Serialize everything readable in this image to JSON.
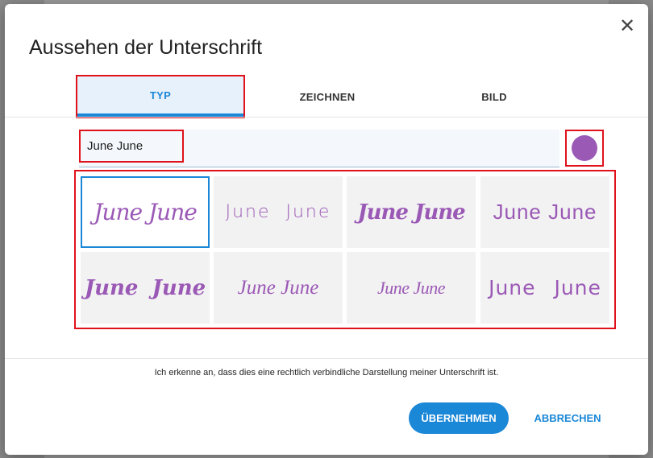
{
  "dialog": {
    "title": "Aussehen der Unterschrift",
    "close_icon": "close-icon"
  },
  "tabs": [
    {
      "label": "TYP",
      "active": true
    },
    {
      "label": "ZEICHNEN",
      "active": false
    },
    {
      "label": "BILD",
      "active": false
    }
  ],
  "name_input": {
    "value": "June June"
  },
  "color": {
    "selected": "#9b59b6",
    "icon": "color-picker-swatch"
  },
  "signature_styles": [
    {
      "text": "June June",
      "selected": true
    },
    {
      "text": "June June",
      "selected": false
    },
    {
      "text": "June June",
      "selected": false
    },
    {
      "text": "June June",
      "selected": false
    },
    {
      "text": "June June",
      "selected": false
    },
    {
      "text": "June June",
      "selected": false
    },
    {
      "text": "June June",
      "selected": false
    },
    {
      "text": "June June",
      "selected": false
    }
  ],
  "consent_text": "Ich erkenne an, dass dies eine rechtlich verbindliche Darstellung meiner Unterschrift ist.",
  "buttons": {
    "apply_label": "ÜBERNEHMEN",
    "cancel_label": "ABBRECHEN"
  },
  "colors": {
    "accent": "#1a87d7",
    "signature": "#9b59b6",
    "annotation": "#e0111b"
  }
}
